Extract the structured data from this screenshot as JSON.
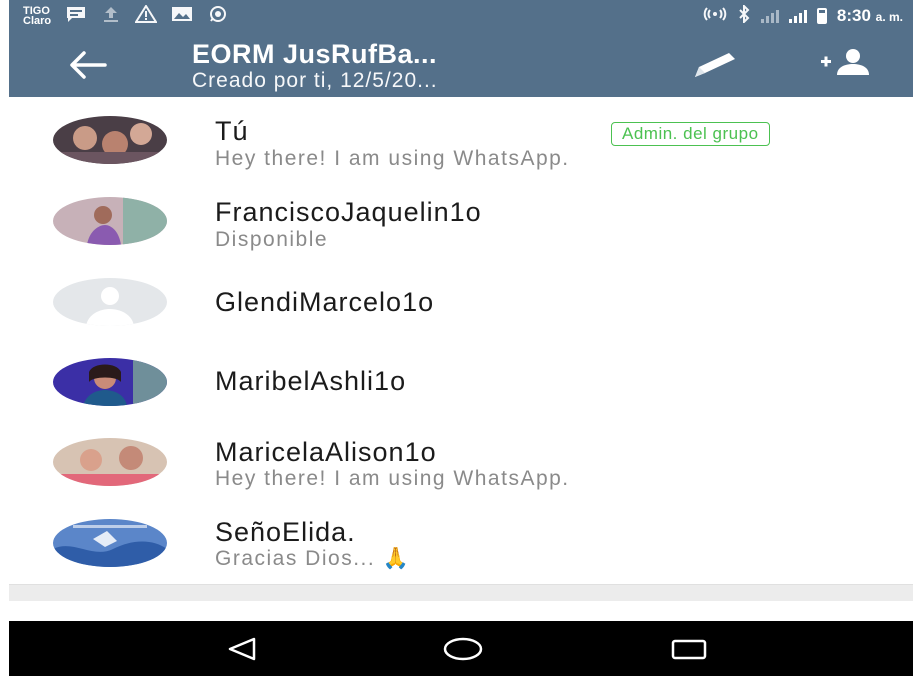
{
  "status_bar": {
    "carrier_top": "TIGO",
    "carrier_bottom": "Claro",
    "clock": "8:30",
    "ampm": "a. m.",
    "icons": [
      "message-icon",
      "upload-icon",
      "warning-icon",
      "image-icon",
      "whatsapp-icon",
      "hotspot-icon",
      "bluetooth-icon",
      "signal-icon",
      "battery-icon"
    ]
  },
  "header": {
    "back_icon": "arrow-left-icon",
    "title": "EORM JusRufBa...",
    "subtitle": "Creado por ti, 12/5/20...",
    "edit_icon": "pencil-icon",
    "add_participant_icon": "add-person-icon"
  },
  "members": [
    {
      "name": "Tú",
      "status": "Hey there! I am using WhatsApp.",
      "badge": "Admin. del grupo",
      "avatar_color": "#5a4a52"
    },
    {
      "name": "FranciscoJaquelin1o",
      "status": "Disponible",
      "avatar_color": "#b48aa0"
    },
    {
      "name": "GlendiMarcelo1o",
      "status": "",
      "avatar_color": "#e6e9ec"
    },
    {
      "name": "MaribelAshli1o",
      "status": "",
      "avatar_color": "#4a3aa8"
    },
    {
      "name": "MaricelaAlison1o",
      "status": "Hey there! I am using WhatsApp.",
      "avatar_color": "#c99a92"
    },
    {
      "name": "SeñoElida.",
      "status": "Gracias Dios... 🙏",
      "avatar_color": "#4f7bc4"
    }
  ],
  "colors": {
    "accent": "#54708a",
    "admin_green": "#4cc151",
    "text_primary": "#1b1b1b",
    "text_secondary": "#8a8a8a"
  },
  "nav_bar": {
    "back_icon": "triangle-back-icon",
    "home_icon": "circle-home-icon",
    "recents_icon": "square-recents-icon"
  }
}
